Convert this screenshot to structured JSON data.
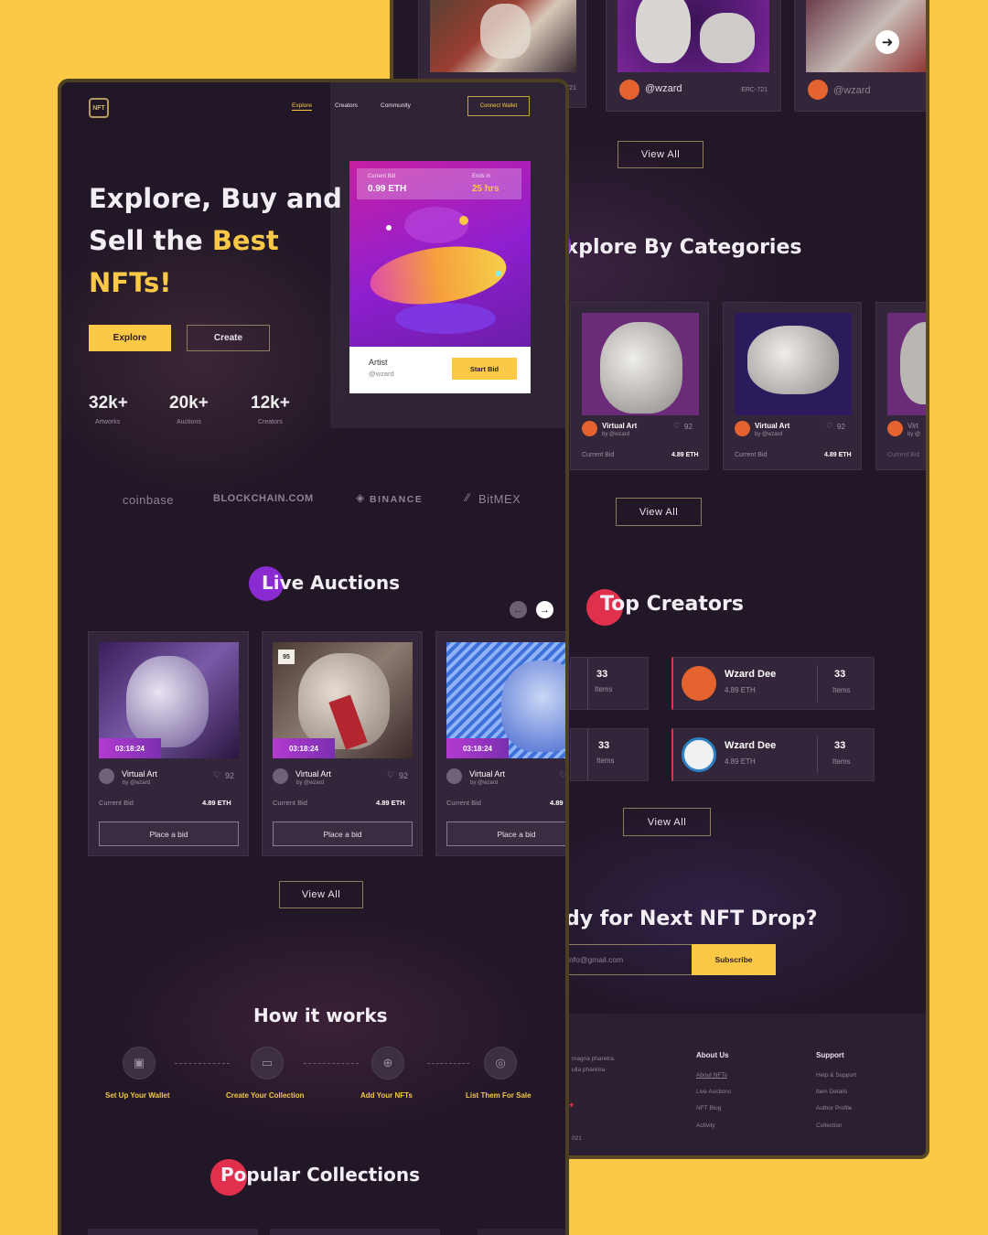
{
  "back": {
    "top_cards": [
      {
        "owner": "",
        "tag": "C-721"
      },
      {
        "owner": "@wzard",
        "tag": "ERC-721"
      },
      {
        "owner": "@wzard",
        "tag": ""
      }
    ],
    "view_all_1": "View All",
    "categories_title": "xplore By Categories",
    "categories": [
      {
        "title": "Virtual Art",
        "by": "by @wzard",
        "likes": "92",
        "bid_label": "Current Bid",
        "bid": "4.89 ETH"
      },
      {
        "title": "Virtual Art",
        "by": "by @wzard",
        "likes": "92",
        "bid_label": "Current Bid",
        "bid": "4.89 ETH"
      },
      {
        "title": "Virt",
        "by": "by @",
        "likes": "",
        "bid_label": "Current Bid",
        "bid": ""
      }
    ],
    "view_all_2": "View All",
    "creators_title": "Top Creators",
    "creators_left": [
      {
        "count": "33",
        "label": "Items"
      },
      {
        "count": "33",
        "label": "Items"
      }
    ],
    "creators": [
      {
        "name": "Wzard Dee",
        "eth": "4.89 ETH",
        "count": "33",
        "label": "Items"
      },
      {
        "name": "Wzard Dee",
        "eth": "4.89 ETH",
        "count": "33",
        "label": "Items"
      }
    ],
    "view_all_3": "View All",
    "drop_title": "dy for Next NFT Drop?",
    "email_placeholder": "nfo@gmail.com",
    "subscribe": "Subscribe",
    "footer": {
      "desc1": "magna pharetra.",
      "desc2": "ulla pharetra",
      "copyright": "021",
      "about_title": "About Us",
      "about_links": [
        "About NFTs",
        "Live Auctions",
        "NFT Blog",
        "Activity"
      ],
      "support_title": "Support",
      "support_links": [
        "Help & Support",
        "Item Details",
        "Author Profile",
        "Collection"
      ]
    }
  },
  "front": {
    "logo": "NFT",
    "nav": [
      "Explore",
      "Creators",
      "Community"
    ],
    "connect": "Connect Wallet",
    "hero_line1": "Explore, Buy and",
    "hero_line2a": "Sell the ",
    "hero_line2b": "Best",
    "hero_line3": "NFTs!",
    "explore_btn": "Explore",
    "create_btn": "Create",
    "stats": [
      {
        "value": "32k+",
        "label": "Artworks"
      },
      {
        "value": "20k+",
        "label": "Auctions"
      },
      {
        "value": "12k+",
        "label": "Creators"
      }
    ],
    "hero_card": {
      "bid_label": "Current Bid",
      "bid": "0.99 ETH",
      "ends_label": "Ends in",
      "ends": "25 hrs",
      "artist_label": "Artist",
      "artist": "@wzard",
      "start_bid": "Start Bid"
    },
    "partners": [
      "coinbase",
      "BLOCKCHAIN.COM",
      "BINANCE",
      "BitMEX"
    ],
    "live_title": "Live Auctions",
    "auctions": [
      {
        "timer": "03:18:24",
        "title": "Virtual Art",
        "by": "by @wzard",
        "likes": "92",
        "bid_label": "Current Bid",
        "bid": "4.89 ETH",
        "button": "Place a bid"
      },
      {
        "timer": "03:18:24",
        "title": "Virtual Art",
        "by": "by @wzard",
        "likes": "92",
        "bid_label": "Current Bid",
        "bid": "4.89 ETH",
        "button": "Place a bid",
        "badge": "95"
      },
      {
        "timer": "03:18:24",
        "title": "Virtual Art",
        "by": "by @wzard",
        "likes": "",
        "bid_label": "Current Bid",
        "bid": "4.89",
        "button": "Place a bid"
      }
    ],
    "view_all": "View All",
    "how_title": "How it works",
    "steps": [
      "Set Up Your Wallet",
      "Create Your Collection",
      "Add Your NFTs",
      "List Them For Sale"
    ],
    "popular_title": "Popular Collections"
  },
  "colors": {
    "accent": "#fbc946",
    "bg": "#211726",
    "card": "#33263a",
    "purple": "#8a2bd1",
    "red": "#e0304e"
  }
}
